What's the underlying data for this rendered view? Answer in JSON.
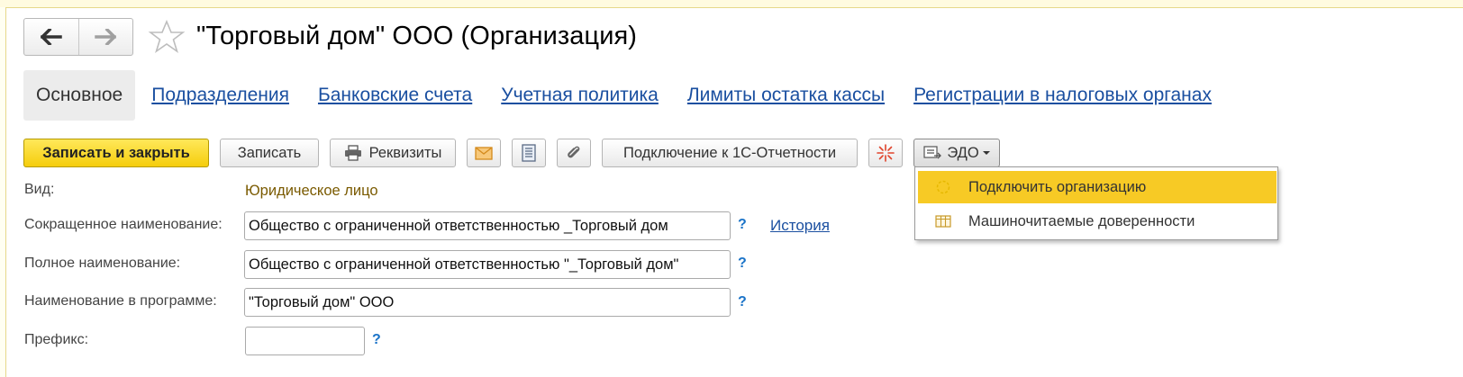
{
  "window": {
    "title": "\"Торговый дом\" ООО (Организация)"
  },
  "tabs": [
    {
      "label": "Основное"
    },
    {
      "label": "Подразделения"
    },
    {
      "label": "Банковские счета"
    },
    {
      "label": "Учетная политика"
    },
    {
      "label": "Лимиты остатка кассы"
    },
    {
      "label": "Регистрации в налоговых органах"
    }
  ],
  "toolbar": {
    "save_close": "Записать и закрыть",
    "save": "Записать",
    "requisites": "Реквизиты",
    "connect": "Подключение к 1С-Отчетности",
    "edo": "ЭДО"
  },
  "edo_menu": {
    "items": [
      {
        "label": "Подключить организацию",
        "icon": "connect-icon"
      },
      {
        "label": "Машиночитаемые доверенности",
        "icon": "table-icon"
      }
    ]
  },
  "form": {
    "kind_label": "Вид:",
    "kind_value": "Юридическое лицо",
    "short_name_label": "Сокращенное наименование:",
    "short_name_value": "Общество с ограниченной ответственностью _Торговый дом",
    "full_name_label": "Полное наименование:",
    "full_name_value": "Общество с ограниченной ответственностью \"_Торговый дом\"",
    "program_name_label": "Наименование в программе:",
    "program_name_value": "\"Торговый дом\" ООО",
    "prefix_label": "Префикс:",
    "prefix_value": "",
    "help_mark": "?",
    "history_link": "История"
  },
  "colors": {
    "primary_button": "#f5cd0c",
    "link": "#1a4fa0",
    "menu_highlight": "#f7ca25",
    "kind_value": "#7a5a00"
  }
}
